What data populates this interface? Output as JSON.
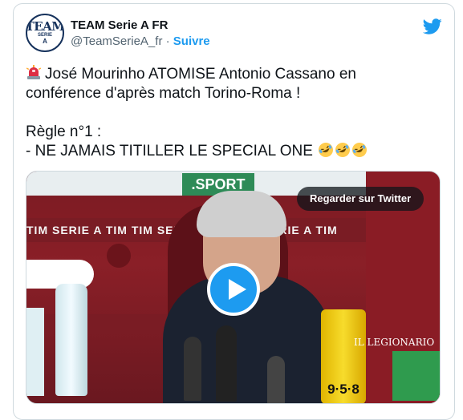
{
  "tweet": {
    "author": {
      "display_name": "TEAM Serie A FR",
      "handle": "@TeamSerieA_fr",
      "separator": " · ",
      "follow_label": "Suivre",
      "avatar_text": {
        "line1": "TEAM",
        "line2": "SERIE",
        "line3": "A"
      }
    },
    "text_lines": [
      "José Mourinho ATOMISE Antonio Cassano en",
      "conférence d'après match Torino-Roma !",
      "",
      "Règle n°1 :",
      "- NE JAMAIS TITILLER LE SPECIAL ONE"
    ],
    "emoji": {
      "leading": "police-car-light-icon",
      "trailing": [
        "rofl-icon",
        "rofl-icon",
        "rofl-icon"
      ]
    },
    "media": {
      "watch_label": "Regarder sur Twitter",
      "overlay_texts": {
        "sport": ".SPORT",
        "sponsor_bar": "TIM SERIE A TIM  TIM SERIE A TIM  TIM SERIE A TIM",
        "can_number": "9·5·8",
        "watermark": "IL LEGIONARIO"
      }
    }
  },
  "colors": {
    "accent": "#1d9bf0",
    "text": "#0f1419",
    "muted": "#536471",
    "border": "#cfd9de"
  }
}
